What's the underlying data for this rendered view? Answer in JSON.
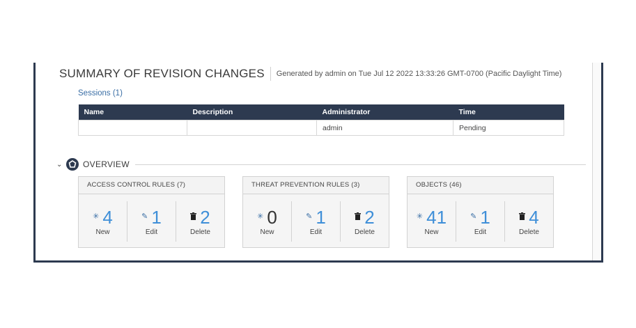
{
  "header": {
    "title": "SUMMARY OF REVISION CHANGES",
    "generated": "Generated by admin on Tue Jul 12 2022 13:33:26 GMT-0700 (Pacific Daylight Time)"
  },
  "sessions": {
    "link_label": "Sessions (1)",
    "columns": [
      "Name",
      "Description",
      "Administrator",
      "Time"
    ],
    "rows": [
      {
        "name": "",
        "description": "",
        "administrator": "admin",
        "time": "Pending"
      }
    ]
  },
  "overview": {
    "label": "OVERVIEW",
    "cards": [
      {
        "title": "ACCESS CONTROL RULES (7)",
        "stats": [
          {
            "icon": "asterisk-icon",
            "glyph": "✳",
            "value": "4",
            "label": "New"
          },
          {
            "icon": "pencil-icon",
            "glyph": "✎",
            "value": "1",
            "label": "Edit"
          },
          {
            "icon": "trash-icon",
            "glyph": "🗑",
            "value": "2",
            "label": "Delete"
          }
        ]
      },
      {
        "title": "THREAT PREVENTION RULES (3)",
        "stats": [
          {
            "icon": "asterisk-icon",
            "glyph": "✳",
            "value": "0",
            "label": "New"
          },
          {
            "icon": "pencil-icon",
            "glyph": "✎",
            "value": "1",
            "label": "Edit"
          },
          {
            "icon": "trash-icon",
            "glyph": "🗑",
            "value": "2",
            "label": "Delete"
          }
        ]
      },
      {
        "title": "OBJECTS (46)",
        "stats": [
          {
            "icon": "asterisk-icon",
            "glyph": "✳",
            "value": "41",
            "label": "New"
          },
          {
            "icon": "pencil-icon",
            "glyph": "✎",
            "value": "1",
            "label": "Edit"
          },
          {
            "icon": "trash-icon",
            "glyph": "🗑",
            "value": "4",
            "label": "Delete"
          }
        ]
      }
    ]
  },
  "colors": {
    "header_bg": "#2d3a50",
    "accent_blue": "#3f8fd8",
    "link_blue": "#3a6ea5"
  }
}
